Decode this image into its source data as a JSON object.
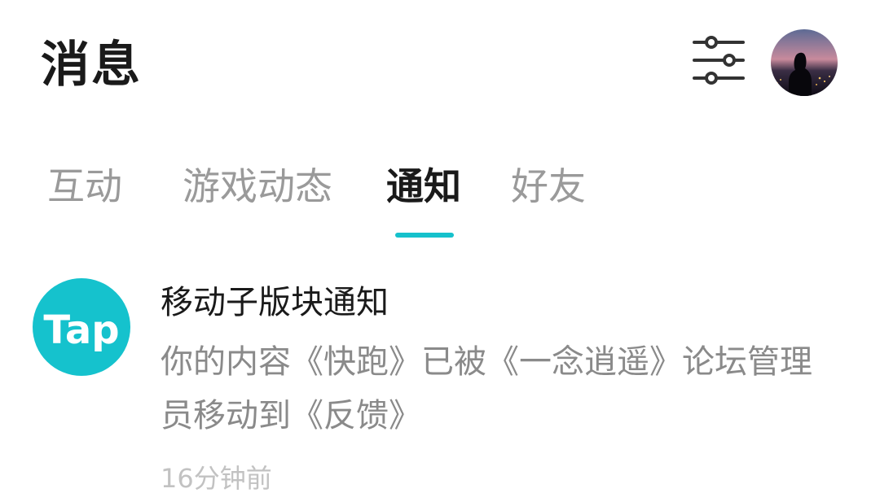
{
  "header": {
    "title": "消息",
    "filter_icon": "sliders-icon",
    "avatar_icon": "user-avatar"
  },
  "tabs": [
    {
      "label": "互动",
      "active": false
    },
    {
      "label": "游戏动态",
      "active": false
    },
    {
      "label": "通知",
      "active": true
    },
    {
      "label": "好友",
      "active": false
    }
  ],
  "notification": {
    "logo_text": "Tap",
    "title": "移动子版块通知",
    "body": "你的内容《快跑》已被《一念逍遥》论坛管理员移动到《反馈》",
    "time": "16分钟前"
  },
  "colors": {
    "accent": "#16c1cc",
    "logo": "#15c2cd",
    "title": "#1a1a1a",
    "muted": "#8a8a8a"
  }
}
